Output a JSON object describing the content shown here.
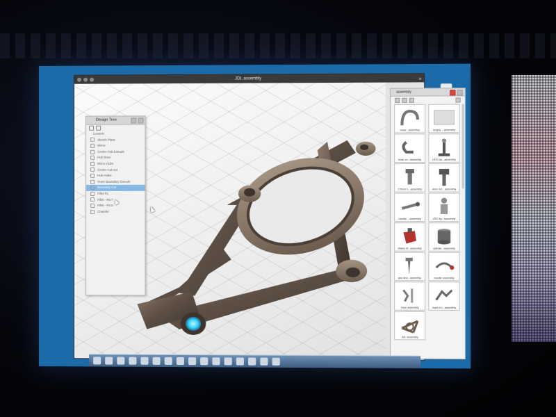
{
  "window": {
    "title": "JDL assembly"
  },
  "design_tree": {
    "title": "Design Tree",
    "items": [
      "Content",
      "Sketch Plane",
      "Mirror",
      "Center Hub Extrude",
      "Hub Boss",
      "Mirror Hubs",
      "Center Cut-out",
      "Hub Holes",
      "Outer Boundary Extrude",
      "Boundary Cut",
      "Fillet R1",
      "Fillet - R0.7",
      "Fillet - R0.5",
      "Chamfer"
    ],
    "selected_index": 9
  },
  "library": {
    "title": "assembly",
    "items": [
      {
        "label": "rebar...assembly",
        "icon": "hook-part-icon"
      },
      {
        "label": "supply ...assembly",
        "icon": "plate-part-icon"
      },
      {
        "label": "hose co...assembly",
        "icon": "clip-part-icon"
      },
      {
        "label": "LED sta...assembly",
        "icon": "stand-part-icon"
      },
      {
        "label": "2.5mm h...assembly",
        "icon": "bolt-part-icon"
      },
      {
        "label": "4mm scr...assembly",
        "icon": "screw-part-icon"
      },
      {
        "label": "handle ...assembly",
        "icon": "handle-part-icon"
      },
      {
        "label": "LED fig...assembly",
        "icon": "figure-part-icon"
      },
      {
        "label": "Maker B...assembly",
        "icon": "maker-part-icon"
      },
      {
        "label": "cylinde...assembly",
        "icon": "cylinder-part-icon"
      },
      {
        "label": "jaw and...assembly",
        "icon": "jaw-part-icon"
      },
      {
        "label": "handle assembly",
        "icon": "lever-part-icon"
      },
      {
        "label": "hose assembly",
        "icon": "hose-part-icon"
      },
      {
        "label": "maxi mo...assembly",
        "icon": "motor-part-icon"
      },
      {
        "label": "JDL assembly",
        "icon": "control-arm-icon"
      }
    ]
  },
  "colors": {
    "accent": "#e0443a",
    "selection": "#86b8e6",
    "part": "#6b5c4e",
    "hub_glow": "#3ad0ff"
  }
}
